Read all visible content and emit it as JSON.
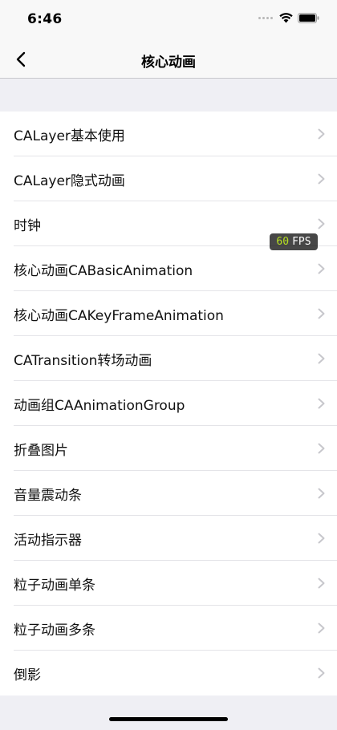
{
  "status_bar": {
    "time": "6:46",
    "signal_icon": "signal-dots-icon",
    "wifi_icon": "wifi-icon",
    "battery_icon": "battery-icon"
  },
  "nav": {
    "back_icon": "chevron-left-icon",
    "title": "核心动画"
  },
  "list": {
    "chevron_icon": "chevron-right-icon",
    "items": [
      "CALayer基本使用",
      "CALayer隐式动画",
      "时钟",
      "核心动画CABasicAnimation",
      "核心动画CAKeyFrameAnimation",
      "CATransition转场动画",
      "动画组CAAnimationGroup",
      "折叠图片",
      "音量震动条",
      "活动指示器",
      "粒子动画单条",
      "粒子动画多条",
      "倒影"
    ]
  },
  "fps_overlay": {
    "value": "60",
    "unit": "FPS"
  },
  "colors": {
    "background": "#efeff4",
    "bar": "#f8f8f8",
    "fps_value": "#b6e020",
    "chevron": "#c7c7cc"
  }
}
